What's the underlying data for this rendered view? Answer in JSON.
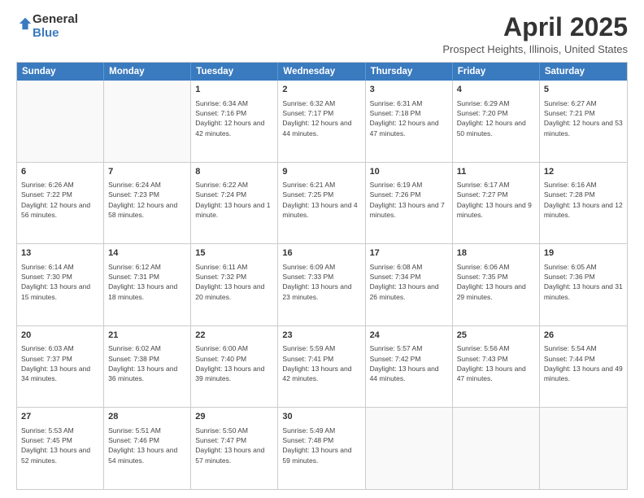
{
  "header": {
    "logo_line1": "General",
    "logo_line2": "Blue",
    "month_title": "April 2025",
    "location": "Prospect Heights, Illinois, United States"
  },
  "days_of_week": [
    "Sunday",
    "Monday",
    "Tuesday",
    "Wednesday",
    "Thursday",
    "Friday",
    "Saturday"
  ],
  "rows": [
    [
      {
        "day": "",
        "empty": true
      },
      {
        "day": "",
        "empty": true
      },
      {
        "day": "1",
        "sunrise": "Sunrise: 6:34 AM",
        "sunset": "Sunset: 7:16 PM",
        "daylight": "Daylight: 12 hours and 42 minutes."
      },
      {
        "day": "2",
        "sunrise": "Sunrise: 6:32 AM",
        "sunset": "Sunset: 7:17 PM",
        "daylight": "Daylight: 12 hours and 44 minutes."
      },
      {
        "day": "3",
        "sunrise": "Sunrise: 6:31 AM",
        "sunset": "Sunset: 7:18 PM",
        "daylight": "Daylight: 12 hours and 47 minutes."
      },
      {
        "day": "4",
        "sunrise": "Sunrise: 6:29 AM",
        "sunset": "Sunset: 7:20 PM",
        "daylight": "Daylight: 12 hours and 50 minutes."
      },
      {
        "day": "5",
        "sunrise": "Sunrise: 6:27 AM",
        "sunset": "Sunset: 7:21 PM",
        "daylight": "Daylight: 12 hours and 53 minutes."
      }
    ],
    [
      {
        "day": "6",
        "sunrise": "Sunrise: 6:26 AM",
        "sunset": "Sunset: 7:22 PM",
        "daylight": "Daylight: 12 hours and 56 minutes."
      },
      {
        "day": "7",
        "sunrise": "Sunrise: 6:24 AM",
        "sunset": "Sunset: 7:23 PM",
        "daylight": "Daylight: 12 hours and 58 minutes."
      },
      {
        "day": "8",
        "sunrise": "Sunrise: 6:22 AM",
        "sunset": "Sunset: 7:24 PM",
        "daylight": "Daylight: 13 hours and 1 minute."
      },
      {
        "day": "9",
        "sunrise": "Sunrise: 6:21 AM",
        "sunset": "Sunset: 7:25 PM",
        "daylight": "Daylight: 13 hours and 4 minutes."
      },
      {
        "day": "10",
        "sunrise": "Sunrise: 6:19 AM",
        "sunset": "Sunset: 7:26 PM",
        "daylight": "Daylight: 13 hours and 7 minutes."
      },
      {
        "day": "11",
        "sunrise": "Sunrise: 6:17 AM",
        "sunset": "Sunset: 7:27 PM",
        "daylight": "Daylight: 13 hours and 9 minutes."
      },
      {
        "day": "12",
        "sunrise": "Sunrise: 6:16 AM",
        "sunset": "Sunset: 7:28 PM",
        "daylight": "Daylight: 13 hours and 12 minutes."
      }
    ],
    [
      {
        "day": "13",
        "sunrise": "Sunrise: 6:14 AM",
        "sunset": "Sunset: 7:30 PM",
        "daylight": "Daylight: 13 hours and 15 minutes."
      },
      {
        "day": "14",
        "sunrise": "Sunrise: 6:12 AM",
        "sunset": "Sunset: 7:31 PM",
        "daylight": "Daylight: 13 hours and 18 minutes."
      },
      {
        "day": "15",
        "sunrise": "Sunrise: 6:11 AM",
        "sunset": "Sunset: 7:32 PM",
        "daylight": "Daylight: 13 hours and 20 minutes."
      },
      {
        "day": "16",
        "sunrise": "Sunrise: 6:09 AM",
        "sunset": "Sunset: 7:33 PM",
        "daylight": "Daylight: 13 hours and 23 minutes."
      },
      {
        "day": "17",
        "sunrise": "Sunrise: 6:08 AM",
        "sunset": "Sunset: 7:34 PM",
        "daylight": "Daylight: 13 hours and 26 minutes."
      },
      {
        "day": "18",
        "sunrise": "Sunrise: 6:06 AM",
        "sunset": "Sunset: 7:35 PM",
        "daylight": "Daylight: 13 hours and 29 minutes."
      },
      {
        "day": "19",
        "sunrise": "Sunrise: 6:05 AM",
        "sunset": "Sunset: 7:36 PM",
        "daylight": "Daylight: 13 hours and 31 minutes."
      }
    ],
    [
      {
        "day": "20",
        "sunrise": "Sunrise: 6:03 AM",
        "sunset": "Sunset: 7:37 PM",
        "daylight": "Daylight: 13 hours and 34 minutes."
      },
      {
        "day": "21",
        "sunrise": "Sunrise: 6:02 AM",
        "sunset": "Sunset: 7:38 PM",
        "daylight": "Daylight: 13 hours and 36 minutes."
      },
      {
        "day": "22",
        "sunrise": "Sunrise: 6:00 AM",
        "sunset": "Sunset: 7:40 PM",
        "daylight": "Daylight: 13 hours and 39 minutes."
      },
      {
        "day": "23",
        "sunrise": "Sunrise: 5:59 AM",
        "sunset": "Sunset: 7:41 PM",
        "daylight": "Daylight: 13 hours and 42 minutes."
      },
      {
        "day": "24",
        "sunrise": "Sunrise: 5:57 AM",
        "sunset": "Sunset: 7:42 PM",
        "daylight": "Daylight: 13 hours and 44 minutes."
      },
      {
        "day": "25",
        "sunrise": "Sunrise: 5:56 AM",
        "sunset": "Sunset: 7:43 PM",
        "daylight": "Daylight: 13 hours and 47 minutes."
      },
      {
        "day": "26",
        "sunrise": "Sunrise: 5:54 AM",
        "sunset": "Sunset: 7:44 PM",
        "daylight": "Daylight: 13 hours and 49 minutes."
      }
    ],
    [
      {
        "day": "27",
        "sunrise": "Sunrise: 5:53 AM",
        "sunset": "Sunset: 7:45 PM",
        "daylight": "Daylight: 13 hours and 52 minutes."
      },
      {
        "day": "28",
        "sunrise": "Sunrise: 5:51 AM",
        "sunset": "Sunset: 7:46 PM",
        "daylight": "Daylight: 13 hours and 54 minutes."
      },
      {
        "day": "29",
        "sunrise": "Sunrise: 5:50 AM",
        "sunset": "Sunset: 7:47 PM",
        "daylight": "Daylight: 13 hours and 57 minutes."
      },
      {
        "day": "30",
        "sunrise": "Sunrise: 5:49 AM",
        "sunset": "Sunset: 7:48 PM",
        "daylight": "Daylight: 13 hours and 59 minutes."
      },
      {
        "day": "",
        "empty": true
      },
      {
        "day": "",
        "empty": true
      },
      {
        "day": "",
        "empty": true
      }
    ]
  ]
}
